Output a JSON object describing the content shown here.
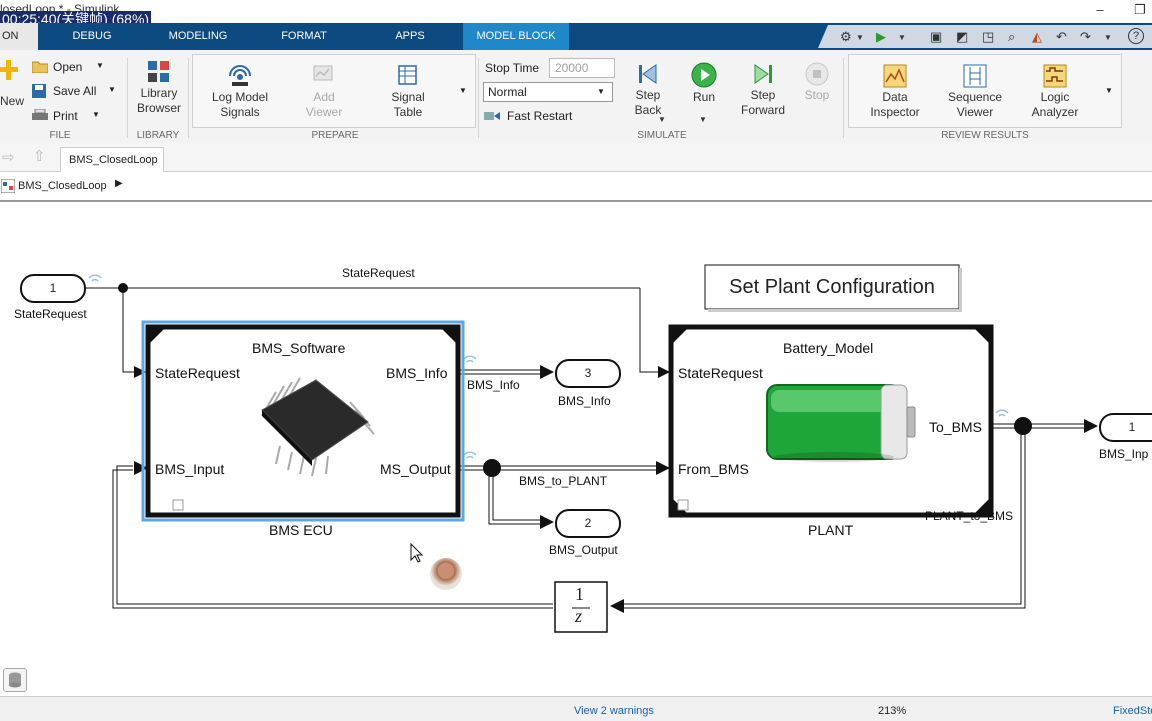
{
  "window": {
    "title": "losedLoop * - Simulink",
    "overlay": "00:25:40(关键帧) (68%)",
    "minimize": "–",
    "restore": "❐"
  },
  "tabs": [
    "ON",
    "DEBUG",
    "MODELING",
    "FORMAT",
    "APPS",
    "MODEL BLOCK"
  ],
  "ribbon": {
    "file": {
      "label": "FILE",
      "new": "New",
      "open": "Open",
      "save_all": "Save All",
      "print": "Print"
    },
    "library": {
      "label": "LIBRARY",
      "browser": "Library Browser"
    },
    "prepare": {
      "label": "PREPARE",
      "log_signals": "Log Model Signals",
      "add_viewer": "Add Viewer",
      "signal_table": "Signal Table"
    },
    "simulate": {
      "label": "SIMULATE",
      "stop_time_label": "Stop Time",
      "stop_time_value": "20000",
      "mode": "Normal",
      "fast_restart": "Fast Restart",
      "step_back": "Step Back",
      "run": "Run",
      "step_forward": "Step Forward",
      "stop": "Stop"
    },
    "review": {
      "label": "REVIEW RESULTS",
      "data_inspector": "Data Inspector",
      "sequence_viewer": "Sequence Viewer",
      "logic_analyzer": "Logic Analyzer"
    }
  },
  "nav": {
    "model_tab": "BMS_ClosedLoop"
  },
  "breadcrumb": {
    "item": "BMS_ClosedLoop"
  },
  "diagram": {
    "inport1": {
      "number": "1",
      "label": "StateRequest"
    },
    "signal_state_request": "StateRequest",
    "annotation": "Set Plant Configuration",
    "ecu": {
      "title": "BMS_Software",
      "name": "BMS ECU",
      "in1": "StateRequest",
      "in2": "BMS_Input",
      "out1": "BMS_Info",
      "out2": "MS_Output"
    },
    "plant": {
      "title": "Battery_Model",
      "name": "PLANT",
      "in1": "StateRequest",
      "in2": "From_BMS",
      "out1": "To_BMS"
    },
    "outport3": {
      "number": "3",
      "label": "BMS_Info"
    },
    "outport2": {
      "number": "2",
      "label": "BMS_Output"
    },
    "outport1": {
      "number": "1",
      "label": "BMS_Inp"
    },
    "signal_bms_info": "BMS_Info",
    "signal_bms_to_plant": "BMS_to_PLANT",
    "signal_plant_to_bms": "PLANT_to_BMS",
    "delay": {
      "num": "1",
      "den": "z"
    }
  },
  "status": {
    "warnings": "View 2 warnings",
    "zoom": "213%",
    "solver": "FixedSte"
  },
  "colors": {
    "tabbar": "#0c4a80",
    "active_tab": "#1f88c9",
    "selection": "#5aa9e6",
    "battery_green": "#1fa63a"
  }
}
